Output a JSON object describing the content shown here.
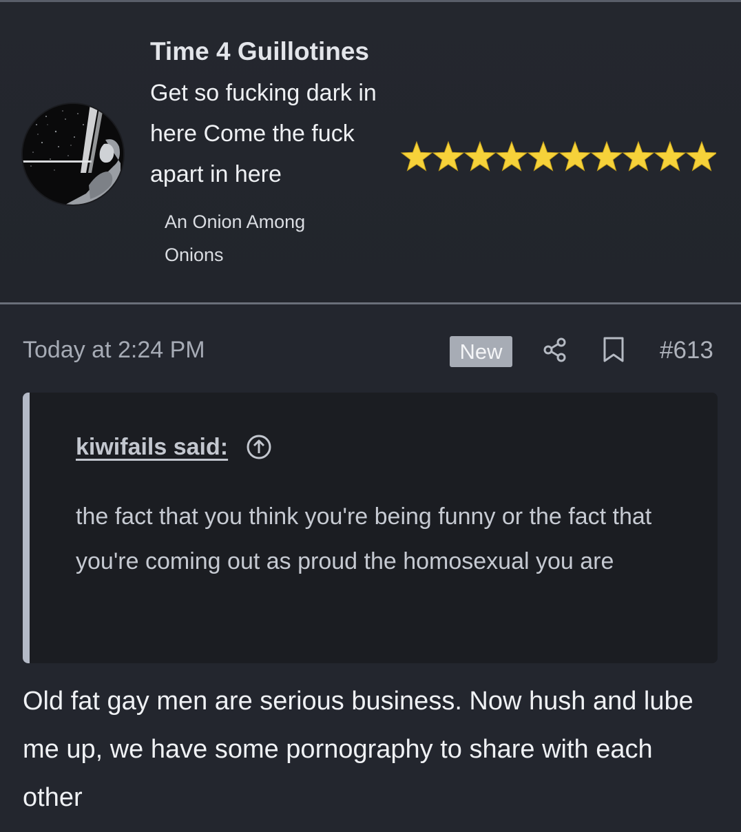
{
  "user_card": {
    "username": "Time 4 Guillotines",
    "custom_title": "Get so fucking dark in here Come the fuck apart in here",
    "banner_text": "An Onion Among Onions",
    "avatar_icon": "user-avatar-image",
    "star_count": 10,
    "star_color": "#f6d23a"
  },
  "post": {
    "date": "Today at 2:24 PM",
    "new_badge": "New",
    "share_icon": "share-icon",
    "bookmark_icon": "bookmark-icon",
    "post_number": "#613",
    "quote": {
      "author_label": "kiwifails said:",
      "jump_icon": "arrow-up-circle-icon",
      "text": "the fact that you think you're being funny or the fact that you're coming out as proud the homosexual you are"
    },
    "body": "Old fat gay men are serious business. Now hush and lube me up, we have some pornography to share with each other"
  },
  "colors": {
    "background": "#23262e",
    "quote_background": "#1b1d22",
    "quote_bar": "#b4bac7",
    "badge_background": "#a7acb5",
    "muted_text": "#a6abb5"
  }
}
